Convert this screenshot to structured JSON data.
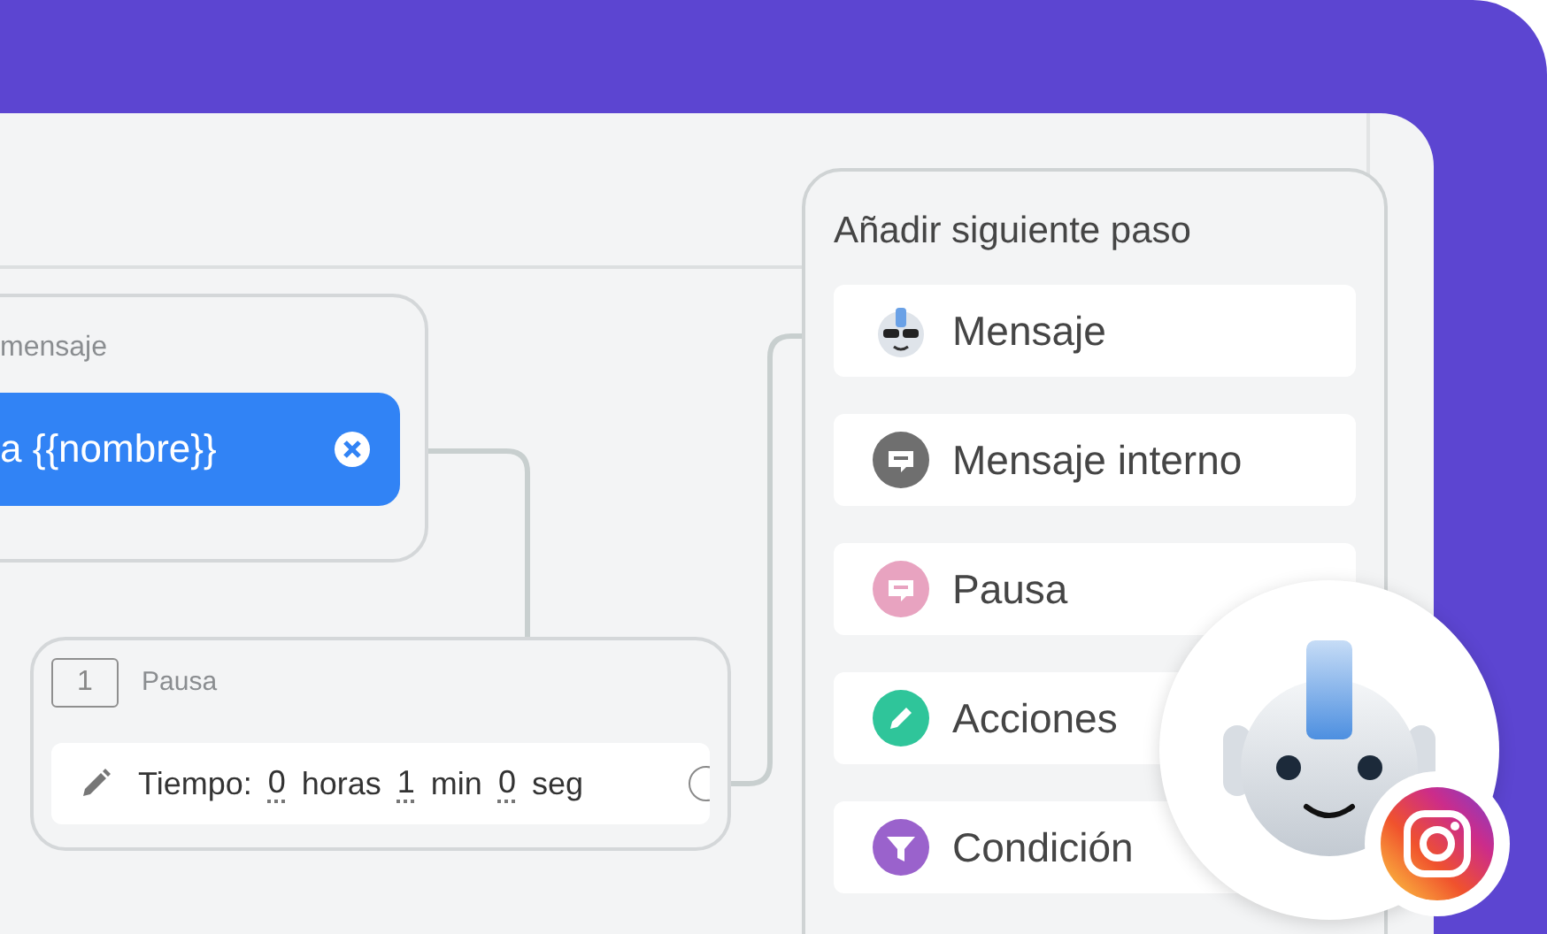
{
  "message_node": {
    "title": "mensaje",
    "bubble_text": "a {{nombre}}"
  },
  "pause_node": {
    "number": "1",
    "title": "Pausa",
    "time_label": "Tiempo:",
    "time_parts": [
      {
        "value": "0",
        "unit": "horas"
      },
      {
        "value": "1",
        "unit": "min"
      },
      {
        "value": "0",
        "unit": "seg"
      }
    ]
  },
  "next_step_menu": {
    "title": "Añadir siguiente paso",
    "items": [
      {
        "label": "Mensaje",
        "kind": "bot"
      },
      {
        "label": "Mensaje interno",
        "kind": "note"
      },
      {
        "label": "Pausa",
        "kind": "pause"
      },
      {
        "label": "Acciones",
        "kind": "action"
      },
      {
        "label": "Condición",
        "kind": "condition"
      }
    ]
  }
}
